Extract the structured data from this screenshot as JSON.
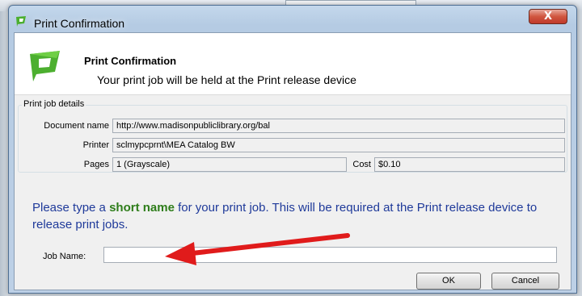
{
  "window": {
    "title": "Print Confirmation",
    "close_label": "X"
  },
  "header": {
    "title": "Print Confirmation",
    "subtitle": "Your print job will be held at the Print release device"
  },
  "details": {
    "group_label": "Print job details",
    "document_name_label": "Document name",
    "document_name_value": "http://www.madisonpubliclibrary.org/bal",
    "printer_label": "Printer",
    "printer_value": "sclmypcprnt\\MEA Catalog BW",
    "pages_label": "Pages",
    "pages_value": "1  (Grayscale)",
    "cost_label": "Cost",
    "cost_value": "$0.10"
  },
  "instruction": {
    "part1": "Please type a ",
    "highlight": "short name",
    "part2": " for your print job. This will be required at the Print release device to release print jobs."
  },
  "job": {
    "label": "Job Name:",
    "value": ""
  },
  "buttons": {
    "ok": "OK",
    "cancel": "Cancel"
  },
  "colors": {
    "instruction_text": "#1f3a9a",
    "highlight_text": "#2e7d1a",
    "arrow": "#e01b1b",
    "logo_green": "#4caf2f"
  },
  "icons": [
    "papercut-logo-icon",
    "close-icon",
    "red-arrow-annotation"
  ]
}
